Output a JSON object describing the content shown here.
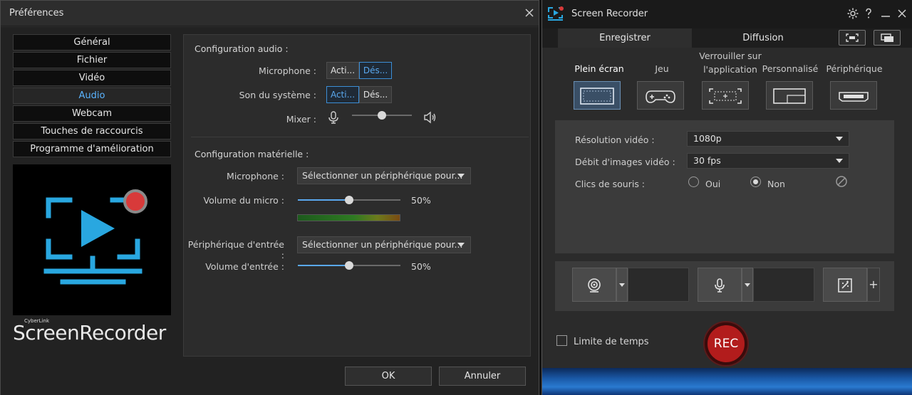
{
  "prefs": {
    "title": "Préférences",
    "nav": [
      "Général",
      "Fichier",
      "Vidéo",
      "Audio",
      "Webcam",
      "Touches de raccourcis",
      "Programme d'amélioration"
    ],
    "nav_active": "Audio",
    "brand_small": "CyberLink",
    "brand_big": "ScreenRecorder",
    "audio": {
      "section_title": "Configuration audio :",
      "microphone_label": "Microphone :",
      "system_sound_label": "Son du système :",
      "on_label": "Acti...",
      "off_label": "Dés...",
      "microphone_state": "Dés...",
      "system_sound_state": "Acti...",
      "mixer_label": "Mixer :",
      "mixer_level": 0.5
    },
    "hardware": {
      "section_title": "Configuration matérielle :",
      "microphone_label": "Microphone :",
      "microphone_value": "Sélectionner un périphérique pour...",
      "mic_volume_label": "Volume du micro :",
      "mic_volume_percent": "50%",
      "mic_volume_level": 0.5,
      "input_device_label": "Périphérique d'entrée :",
      "input_device_value": "Sélectionner un périphérique pour...",
      "input_volume_label": "Volume d'entrée :",
      "input_volume_percent": "50%",
      "input_volume_level": 0.5
    },
    "ok_label": "OK",
    "cancel_label": "Annuler"
  },
  "recorder": {
    "title": "Screen Recorder",
    "tabs": [
      "Enregistrer",
      "Diffusion"
    ],
    "active_tab": "Enregistrer",
    "modes": [
      "Plein écran",
      "Jeu",
      "Verrouiller sur l'application",
      "Personnalisé",
      "Périphérique"
    ],
    "active_mode": "Plein écran",
    "resolution_label": "Résolution vidéo :",
    "resolution_value": "1080p",
    "framerate_label": "Débit d'images vidéo :",
    "framerate_value": "30 fps",
    "mouse_clicks_label": "Clics de souris :",
    "mouse_yes": "Oui",
    "mouse_no": "Non",
    "mouse_selected": "Non",
    "time_limit_label": "Limite de temps",
    "rec_label": "REC",
    "accent": "#5aa8ee",
    "rec_color": "#b21c1c"
  }
}
